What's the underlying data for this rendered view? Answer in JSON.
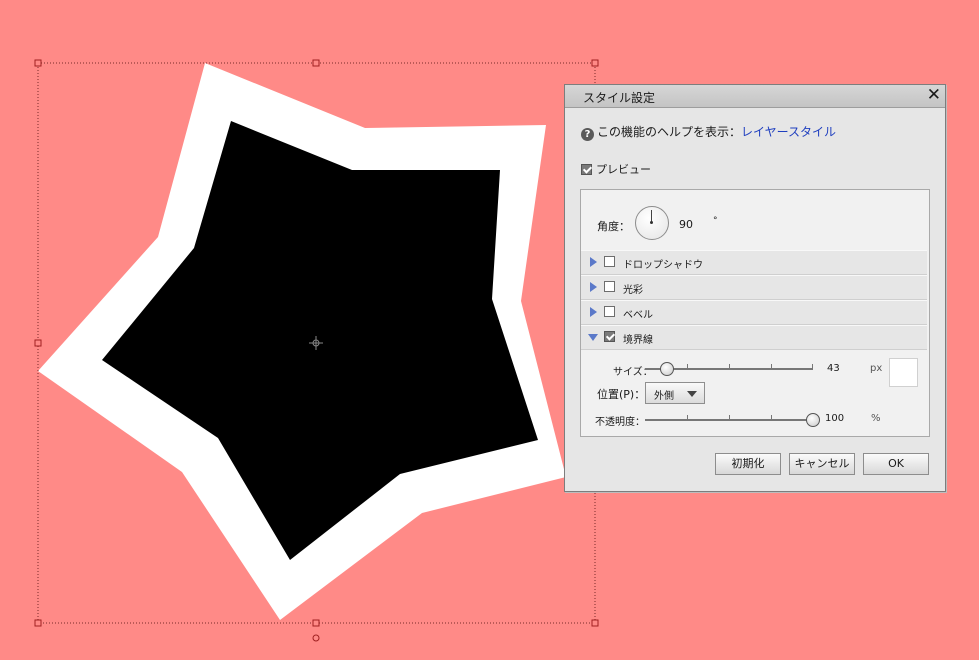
{
  "colors": {
    "canvas_background": "#ff8a87",
    "star_fill": "#000000",
    "star_stroke": "#ffffff",
    "link": "#1f3fbf",
    "section_arrow": "#5b79c9"
  },
  "canvas": {
    "shape": "star",
    "center_marker_icon": "crosshair-icon"
  },
  "dialog": {
    "title": "スタイル設定",
    "close_label": "✕",
    "help_prefix": "この機能のヘルプを表示：",
    "help_link": "レイヤースタイル",
    "help_icon": "?",
    "preview_label": "プレビュー",
    "preview_checked": true,
    "angle_label": "角度：",
    "angle_value": "90",
    "angle_unit": "°",
    "sections": [
      {
        "label": "ドロップシャドウ",
        "checked": false,
        "expanded": false
      },
      {
        "label": "光彩",
        "checked": false,
        "expanded": false
      },
      {
        "label": "ベベル",
        "checked": false,
        "expanded": false
      },
      {
        "label": "境界線",
        "checked": true,
        "expanded": true
      }
    ],
    "stroke": {
      "size_label": "サイズ：",
      "size_value": "43",
      "size_unit": "px",
      "size_fraction": 0.13,
      "position_label": "位置(P)：",
      "position_value": "外側",
      "opacity_label": "不透明度：",
      "opacity_value": "100",
      "opacity_unit": "%",
      "opacity_fraction": 1.0,
      "color": "#ffffff"
    },
    "buttons": {
      "reset": "初期化",
      "cancel": "キャンセル",
      "ok": "OK"
    }
  }
}
